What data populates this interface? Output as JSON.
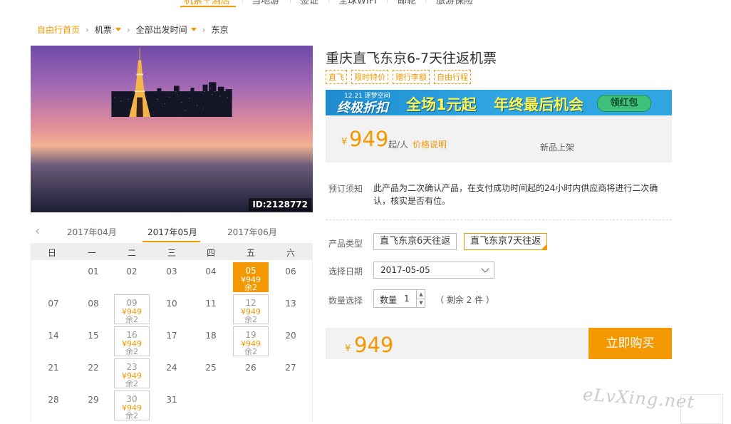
{
  "nav": {
    "items": [
      "机票＋酒店",
      "当地游",
      "签证",
      "全球WIFI",
      "邮轮",
      "旅游保险"
    ],
    "active_index": 0
  },
  "breadcrumb": {
    "home": "自由行首页",
    "category": "机票",
    "departure": "全部出发时间",
    "destination": "东京"
  },
  "hero": {
    "id_label": "ID:2128772"
  },
  "calendar": {
    "months": [
      "2017年04月",
      "2017年05月",
      "2017年06月"
    ],
    "current_month_index": 1,
    "weekdays": [
      "日",
      "一",
      "二",
      "三",
      "四",
      "五",
      "六"
    ],
    "weeks": [
      [
        {
          "d": ""
        },
        {
          "d": "01"
        },
        {
          "d": "02"
        },
        {
          "d": "03"
        },
        {
          "d": "04"
        },
        {
          "d": "05",
          "p": "¥949",
          "r": "余2",
          "sel": true
        },
        {
          "d": "06"
        }
      ],
      [
        {
          "d": "07"
        },
        {
          "d": "08"
        },
        {
          "d": "09",
          "p": "¥949",
          "r": "余2"
        },
        {
          "d": "10"
        },
        {
          "d": "11"
        },
        {
          "d": "12",
          "p": "¥949",
          "r": "余2"
        },
        {
          "d": "13"
        }
      ],
      [
        {
          "d": "14"
        },
        {
          "d": "15"
        },
        {
          "d": "16",
          "p": "¥949",
          "r": "余2"
        },
        {
          "d": "17"
        },
        {
          "d": "18"
        },
        {
          "d": "19",
          "p": "¥949",
          "r": "余2"
        },
        {
          "d": "20"
        }
      ],
      [
        {
          "d": "21"
        },
        {
          "d": "22"
        },
        {
          "d": "23",
          "p": "¥949",
          "r": "余2"
        },
        {
          "d": "24"
        },
        {
          "d": "25"
        },
        {
          "d": "26"
        },
        {
          "d": "27"
        }
      ],
      [
        {
          "d": "28"
        },
        {
          "d": "29"
        },
        {
          "d": "30",
          "p": "¥949",
          "r": "余2"
        },
        {
          "d": "31"
        },
        {
          "d": ""
        },
        {
          "d": ""
        },
        {
          "d": ""
        }
      ]
    ]
  },
  "product": {
    "title": "重庆直飞东京6-7天往返机票",
    "tags": [
      "直飞",
      "限时特价",
      "赠行李额",
      "自由行程"
    ]
  },
  "banner": {
    "date": "12.21 逐梦空间",
    "t1": "终极折扣",
    "t2": "全场1元起",
    "t3": "年终最后机会",
    "button": "领红包",
    "bg_color": "#2fa6e2",
    "accent_color": "#fff34d"
  },
  "price": {
    "currency": "¥",
    "amount": "949",
    "unit": "起/人",
    "note": "价格说明",
    "badge": "新品上架"
  },
  "notice": {
    "label": "预订须知",
    "text": "此产品为二次确认产品，在支付成功时间起的24小时内供应商将进行二次确认，核实是否有位。"
  },
  "options": {
    "type_label": "产品类型",
    "types": [
      "直飞东京6天往返",
      "直飞东京7天往返"
    ],
    "selected_type_index": 1,
    "date_label": "选择日期",
    "date_value": "2017-05-05",
    "qty_label": "数量选择",
    "qty_inner_label": "数量",
    "qty_value": "1",
    "remain_text": "（ 剩余 2 件 ）"
  },
  "buy": {
    "currency": "¥",
    "amount": "949",
    "button": "立即购买"
  },
  "watermark": "eLvXing.net",
  "colors": {
    "accent": "#f39800",
    "panel_bg": "#f2f2f2"
  }
}
